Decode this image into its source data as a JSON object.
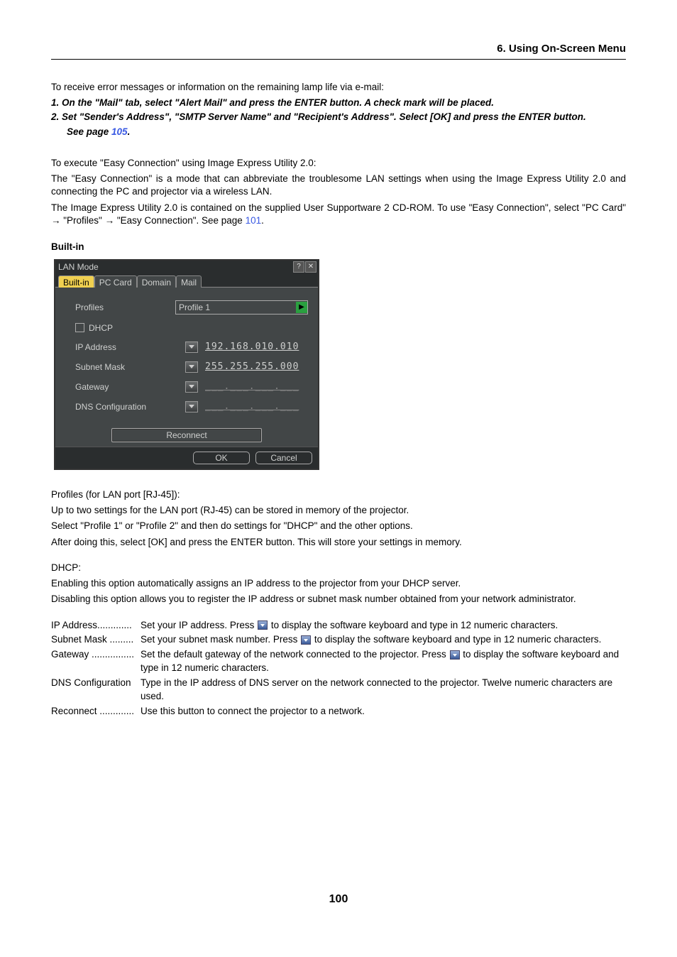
{
  "header": {
    "section": "6. Using On-Screen Menu"
  },
  "intro": {
    "lead": "To receive error messages or information on the remaining lamp life via e-mail:",
    "steps": [
      "1.  On the \"Mail\" tab, select \"Alert Mail\" and press the ENTER button. A check mark will be placed.",
      "2.  Set \"Sender's Address\", \"SMTP Server Name\" and \"Recipient's Address\". Select [OK] and press the ENTER button."
    ],
    "see_page_prefix": "See page ",
    "see_page_num": "105",
    "see_page_suffix": "."
  },
  "easy": {
    "p1": "To execute \"Easy Connection\" using Image Express Utility 2.0:",
    "p2": "The \"Easy Connection\" is a mode that can abbreviate the troublesome LAN settings when using the Image Express Utility 2.0 and connecting the PC and projector via a wireless LAN.",
    "p3_pre": "The Image Express Utility 2.0 is contained on the supplied User Supportware 2 CD-ROM. To use \"Easy Connection\", select \"PC Card\" → \"Profiles\" → \"Easy Connection\". See page ",
    "p3_link": "101",
    "p3_post": "."
  },
  "builtin_heading": "Built-in",
  "dialog": {
    "title": "LAN Mode",
    "help_glyph": "?",
    "close_glyph": "✕",
    "tabs": [
      "Built-in",
      "PC Card",
      "Domain",
      "Mail"
    ],
    "rows": {
      "profiles_label": "Profiles",
      "profiles_value": "Profile 1",
      "dhcp_label": "DHCP",
      "ip_label": "IP Address",
      "ip_value": "192.168.010.010",
      "subnet_label": "Subnet Mask",
      "subnet_value": "255.255.255.000",
      "gateway_label": "Gateway",
      "gateway_value": "___.___.___.___",
      "dns_label": "DNS Configuration",
      "dns_value": "___.___.___.___"
    },
    "reconnect": "Reconnect",
    "ok": "OK",
    "cancel": "Cancel"
  },
  "profiles_block": {
    "h": "Profiles (for LAN port [RJ-45]):",
    "p1": "Up to two settings for the LAN port (RJ-45) can be stored in memory of the projector.",
    "p2": "Select \"Profile 1\" or \"Profile 2\" and then do settings for \"DHCP\" and the other options.",
    "p3": "After doing this, select [OK] and press the ENTER button. This will store your settings in memory."
  },
  "dhcp_block": {
    "h": "DHCP:",
    "p1": "Enabling this option automatically assigns an IP address to the projector from your DHCP server.",
    "p2": "Disabling this option allows you to register the IP address or subnet mask number obtained from your network administrator."
  },
  "defs": {
    "ip": {
      "term": "IP Address.............",
      "text_pre": "Set your IP address. Press ",
      "text_post": " to display the software keyboard and type in 12 numeric characters."
    },
    "subnet": {
      "term": "Subnet Mask .........",
      "text_pre": "Set your subnet mask number. Press ",
      "text_post": " to display the software keyboard and type in 12 numeric characters."
    },
    "gateway": {
      "term": "Gateway ................",
      "text_pre": "Set the default gateway of the network connected to the projector. Press ",
      "text_post": " to display the software keyboard and type in 12 numeric characters."
    },
    "dns": {
      "term": "DNS Configuration",
      "text": "Type in the IP address of DNS server on the network connected to the projector. Twelve numeric characters are used."
    },
    "reconnect": {
      "term": "Reconnect .............",
      "text": "Use this button to connect the projector to a network."
    }
  },
  "page_number": "100",
  "chart_data": null
}
